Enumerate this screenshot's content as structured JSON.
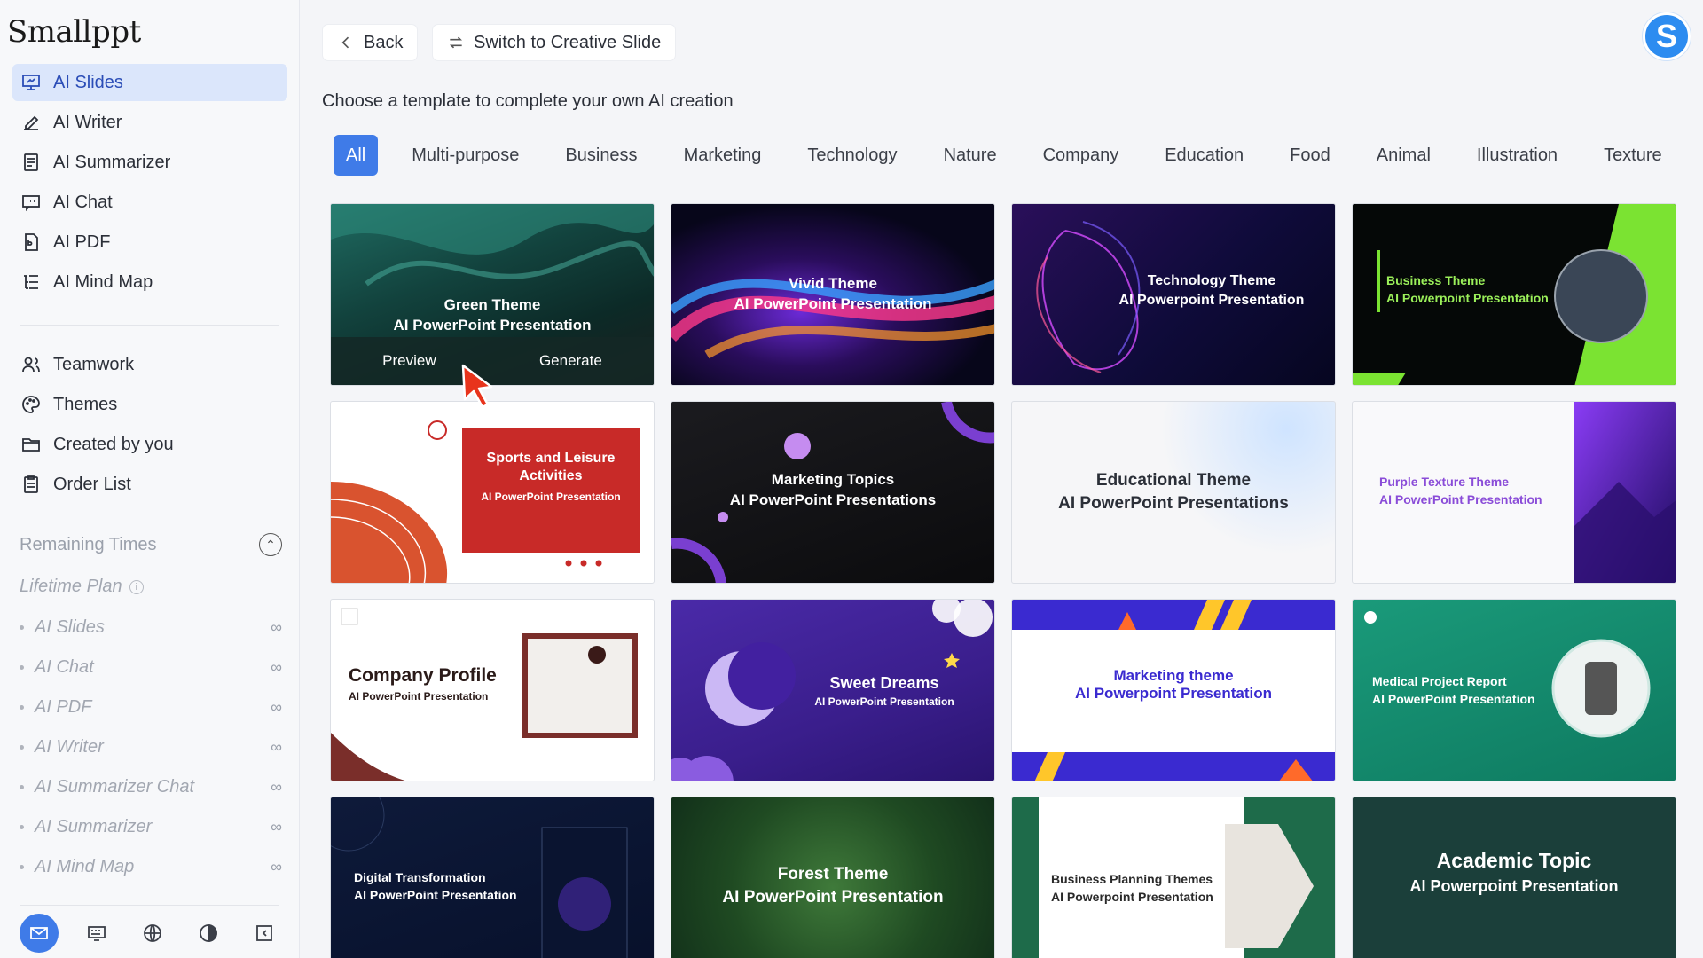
{
  "app": {
    "logo": "Smallppt"
  },
  "sidebar": {
    "main_items": [
      {
        "label": "AI Slides",
        "icon": "presentation-icon",
        "active": true
      },
      {
        "label": "AI Writer",
        "icon": "pen-icon"
      },
      {
        "label": "AI Summarizer",
        "icon": "document-icon"
      },
      {
        "label": "AI Chat",
        "icon": "chat-icon"
      },
      {
        "label": "AI PDF",
        "icon": "pdf-icon"
      },
      {
        "label": "AI Mind Map",
        "icon": "mindmap-icon"
      }
    ],
    "secondary_items": [
      {
        "label": "Teamwork",
        "icon": "team-icon"
      },
      {
        "label": "Themes",
        "icon": "palette-icon"
      },
      {
        "label": "Created by you",
        "icon": "folder-icon"
      },
      {
        "label": "Order List",
        "icon": "clipboard-icon"
      }
    ],
    "remaining_label": "Remaining Times",
    "plan_label": "Lifetime Plan",
    "quotas": [
      {
        "label": "AI Slides",
        "value": "∞"
      },
      {
        "label": "AI Chat",
        "value": "∞"
      },
      {
        "label": "AI PDF",
        "value": "∞"
      },
      {
        "label": "AI Writer",
        "value": "∞"
      },
      {
        "label": "AI Summarizer Chat",
        "value": "∞"
      },
      {
        "label": "AI Summarizer",
        "value": "∞"
      },
      {
        "label": "AI Mind Map",
        "value": "∞"
      }
    ],
    "bottom_icons": [
      "mail-icon",
      "keyboard-icon",
      "globe-icon",
      "contrast-icon",
      "collapse-sidebar-icon"
    ]
  },
  "header": {
    "back_label": "Back",
    "switch_label": "Switch to Creative Slide",
    "avatar_letter": "S",
    "subtitle": "Choose a template to complete your own AI creation"
  },
  "tabs": [
    "All",
    "Multi-purpose",
    "Business",
    "Marketing",
    "Technology",
    "Nature",
    "Company",
    "Education",
    "Food",
    "Animal",
    "Illustration",
    "Texture"
  ],
  "active_tab": "All",
  "templates": [
    {
      "line1": "Green Theme",
      "line2": "AI PowerPoint Presentation",
      "preview": "Preview",
      "generate": "Generate"
    },
    {
      "line1": "Vivid Theme",
      "line2": "AI PowerPoint Presentation"
    },
    {
      "line1": "Technology Theme",
      "line2": "AI Powerpoint Presentation"
    },
    {
      "line1": "Business Theme",
      "line2": "AI Powerpoint Presentation"
    },
    {
      "line1": "Sports and Leisure Activities",
      "line2": "AI PowerPoint Presentation"
    },
    {
      "line1": "Marketing Topics",
      "line2": "AI PowerPoint Presentations"
    },
    {
      "line1": "Educational Theme",
      "line2": "AI PowerPoint Presentations"
    },
    {
      "line1": "Purple Texture Theme",
      "line2": "AI PowerPoint Presentation"
    },
    {
      "line1": "Company Profile",
      "line2": "AI PowerPoint Presentation"
    },
    {
      "line1": "Sweet Dreams",
      "line2": "AI PowerPoint Presentation"
    },
    {
      "line1": "Marketing theme",
      "line2": "AI Powerpoint Presentation"
    },
    {
      "line1": "Medical Project Report",
      "line2": "AI PowerPoint Presentation"
    },
    {
      "line1": "Digital Transformation",
      "line2": "AI PowerPoint Presentation"
    },
    {
      "line1": "Forest Theme",
      "line2": "AI PowerPoint Presentation"
    },
    {
      "line1": "Business Planning Themes",
      "line2": "AI Powerpoint Presentation"
    },
    {
      "line1": "Academic Topic",
      "line2": "AI Powerpoint Presentation"
    }
  ],
  "colors": {
    "accent": "#3f7be8",
    "active_nav_bg": "#dbe6fb"
  }
}
